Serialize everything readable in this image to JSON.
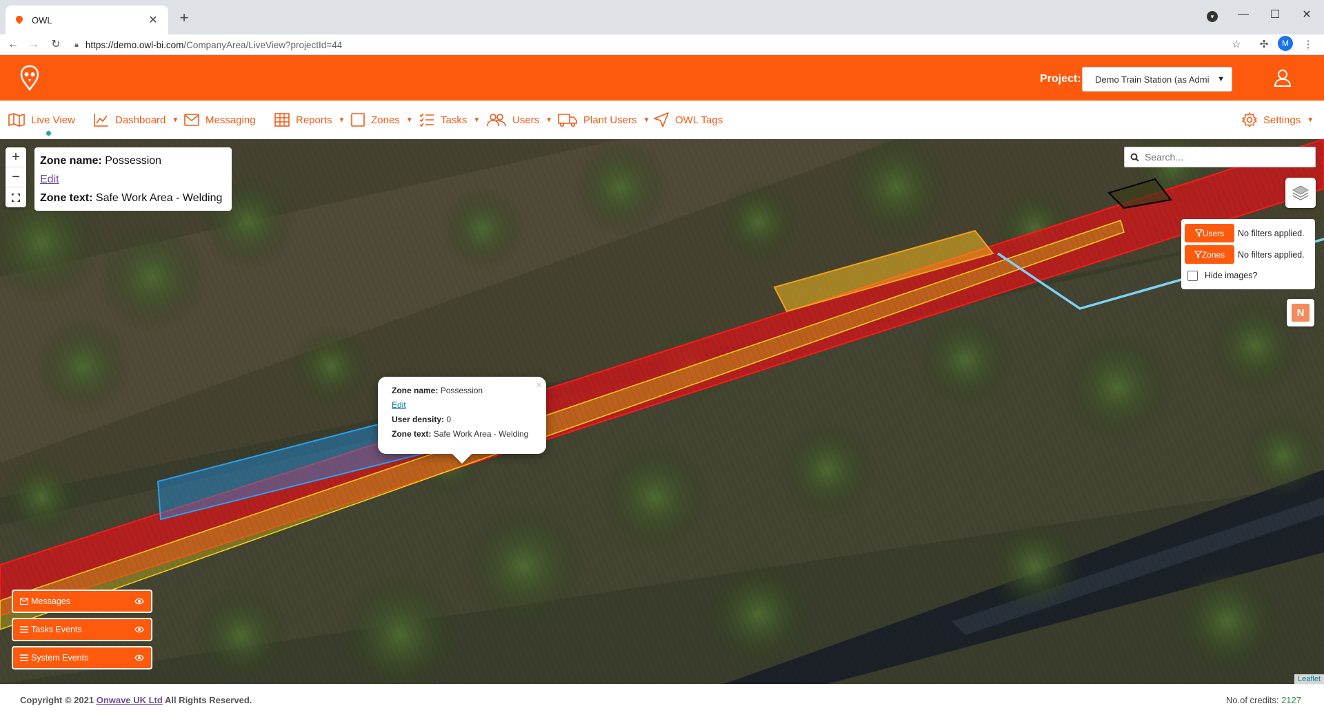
{
  "browser": {
    "tab_title": "OWL",
    "url_host": "https://demo.owl-bi.com",
    "url_path": "/CompanyArea/LiveView?projectId=44",
    "profile_initial": "M"
  },
  "header": {
    "project_label": "Project:",
    "project_value": "Demo Train Station (as Admi"
  },
  "nav": {
    "live_view": "Live View",
    "dashboard": "Dashboard",
    "messaging": "Messaging",
    "reports": "Reports",
    "zones": "Zones",
    "tasks": "Tasks",
    "users": "Users",
    "plant_users": "Plant Users",
    "owl_tags": "OWL Tags",
    "settings": "Settings"
  },
  "map": {
    "zoom_in": "+",
    "zoom_out": "−",
    "infobox": {
      "zone_name_label": "Zone name:",
      "zone_name_value": "Possession",
      "edit_label": "Edit",
      "zone_text_label": "Zone text:",
      "zone_text_value": "Safe Work Area - Welding"
    },
    "popup": {
      "zone_name_label": "Zone name:",
      "zone_name_value": "Possession",
      "edit_label": "Edit",
      "density_label": "User density:",
      "density_value": "0",
      "zone_text_label": "Zone text:",
      "zone_text_value": "Safe Work Area - Welding",
      "close": "×"
    },
    "search_placeholder": "Search...",
    "filters": {
      "users_label": "Users",
      "users_status": "No filters applied.",
      "zones_label": "Zones",
      "zones_status": "No filters applied.",
      "hide_images_label": "Hide images?"
    },
    "n_badge": "N",
    "events": {
      "messages": "Messages",
      "tasks_events": "Tasks Events",
      "system_events": "System Events"
    },
    "attribution": "Leaflet"
  },
  "footer": {
    "copyright_prefix": "Copyright © 2021",
    "company": "Onwave UK Ltd",
    "rights": "All Rights Reserved.",
    "credits_label": "No.of credits:",
    "credits_value": "2127"
  },
  "colors": {
    "brand_orange": "#fd5a0e",
    "zone_red": "#e0161a",
    "zone_yellow": "#f0b81e",
    "zone_blue": "#1e90e0",
    "path_light_blue": "#7fd0f5"
  }
}
